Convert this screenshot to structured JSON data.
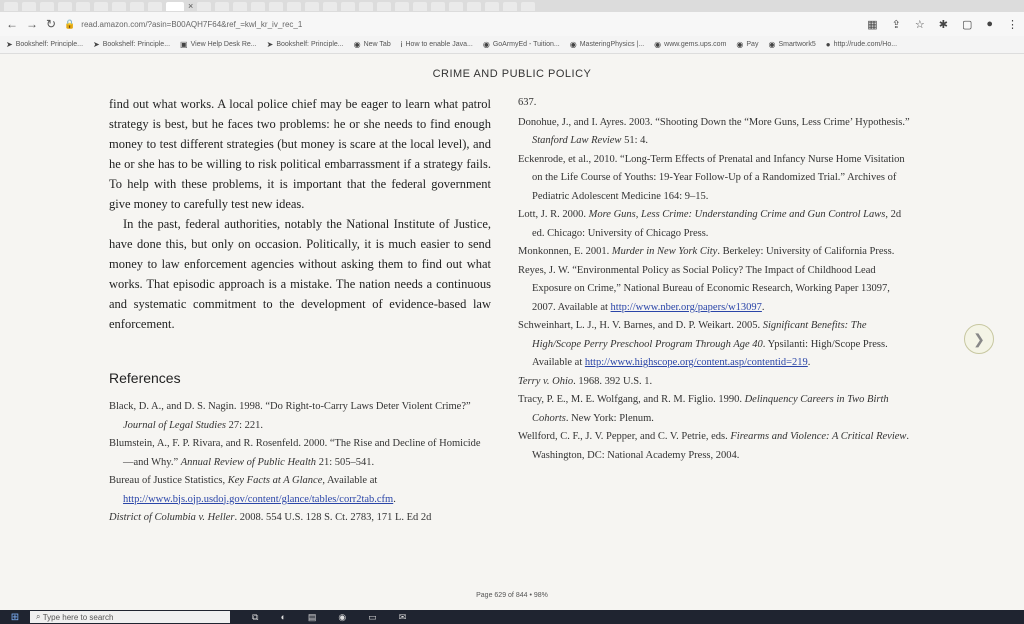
{
  "browser": {
    "address": "read.amazon.com/?asin=B00AQH7F64&ref_=kwl_kr_iv_rec_1",
    "bookmarks": [
      {
        "label": "Bookshelf: Principle...",
        "icon": "arrow-icon"
      },
      {
        "label": "Bookshelf: Principle...",
        "icon": "arrow-icon"
      },
      {
        "label": "View Help Desk Re...",
        "icon": "doc-icon"
      },
      {
        "label": "Bookshelf: Principle...",
        "icon": "arrow-icon"
      },
      {
        "label": "New Tab",
        "icon": "globe-icon"
      },
      {
        "label": "How to enable Java...",
        "icon": "info-icon"
      },
      {
        "label": "GoArmyEd - Tuition...",
        "icon": "globe-icon"
      },
      {
        "label": "MasteringPhysics |...",
        "icon": "globe-icon"
      },
      {
        "label": "www.gems.ups.com",
        "icon": "globe-icon"
      },
      {
        "label": "Pay",
        "icon": "globe-icon"
      },
      {
        "label": "Smartwork5",
        "icon": "globe-icon"
      },
      {
        "label": "http://rude.com/Ho...",
        "icon": "globe-icon"
      }
    ]
  },
  "document": {
    "running_head": "CRIME AND PUBLIC POLICY",
    "left_para_1": "find out what works. A local police chief may be eager to learn what patrol strategy is best, but he faces two problems: he or she needs to find enough money to test different strategies (but money is scare at the local level), and he or she has to be willing to risk political embarrassment if a strategy fails. To help with these problems, it is important that the federal government give money to carefully test new ideas.",
    "left_para_2": "In the past, federal authorities, notably the National Institute of Justice, have done this, but only on occasion. Politically, it is much easier to send money to law enforcement agencies without asking them to find out what works. That episodic approach is a mistake. The nation needs a continuous and systematic commitment to the development of evidence-based law enforcement.",
    "references_heading": "References",
    "left_refs": [
      {
        "pre": "Black, D. A., and D. S. Nagin. 1998. “Do Right-to-Carry Laws Deter Violent Crime?” ",
        "em": "Journal of Legal Studies",
        "post": " 27: 221."
      },
      {
        "pre": "Blumstein, A., F. P. Rivara, and R. Rosenfeld. 2000. “The Rise and Decline of Homicide—and Why.” ",
        "em": "Annual Review of Public Health",
        "post": " 21: 505–541."
      },
      {
        "pre": "Bureau of Justice Statistics, ",
        "em": "Key Facts at A Glance",
        "post": ", Available at ",
        "link": "http://www.bjs.ojp.usdoj.gov/content/glance/tables/corr2tab.cfm",
        "tail": "."
      },
      {
        "pre": "",
        "em": "District of Columbia v. Heller",
        "post": ". 2008. 554 U.S. 128 S. Ct. 2783, 171 L. Ed 2d"
      }
    ],
    "right_continuation": "637.",
    "right_refs": [
      {
        "pre": "Donohue, J., and I. Ayres. 2003. “Shooting Down the “More Guns, Less Crime’ Hypothesis.” ",
        "em": "Stanford Law Review",
        "post": " 51: 4."
      },
      {
        "pre": "Eckenrode, et al., 2010. “Long-Term Effects of Prenatal and Infancy Nurse Home Visitation on the Life Course of Youths: 19-Year Follow-Up of a Randomized Trial.” Archives of Pediatric Adolescent Medicine 164: 9–15.",
        "em": "",
        "post": ""
      },
      {
        "pre": "Lott, J. R. 2000. ",
        "em": "More Guns, Less Crime: Understanding Crime and Gun Control Laws",
        "post": ", 2d ed. Chicago: University of Chicago Press."
      },
      {
        "pre": "Monkonnen, E. 2001. ",
        "em": "Murder in New York City",
        "post": ". Berkeley: University of California Press."
      },
      {
        "pre": "Reyes, J. W. “Environmental Policy as Social Policy? The Impact of Childhood Lead Exposure on Crime,” National Bureau of Economic Research, Working Paper 13097, 2007. Available at ",
        "em": "",
        "post": "",
        "link": "http://www.nber.org/papers/w13097",
        "tail": "."
      },
      {
        "pre": "Schweinhart, L. J., H. V. Barnes, and D. P. Weikart. 2005. ",
        "em": "Significant Benefits: The High/Scope Perry Preschool Program Through Age 40",
        "post": ". Ypsilanti: High/Scope Press. Available at ",
        "link": "http://www.highscope.org/content.asp/contentid=219",
        "tail": "."
      },
      {
        "pre": "",
        "em": "Terry v. Ohio",
        "post": ". 1968. 392 U.S. 1."
      },
      {
        "pre": "Tracy, P. E., M. E. Wolfgang, and R. M. Figlio. 1990. ",
        "em": "Delinquency Careers in Two Birth Cohorts",
        "post": ". New York: Plenum."
      },
      {
        "pre": "Wellford, C. F., J. V. Pepper, and C. V. Petrie, eds. ",
        "em": "Firearms and Violence: A Critical Review",
        "post": ". Washington, DC: National Academy Press, 2004."
      }
    ],
    "page_status": "Page 629 of 844 • 98%"
  },
  "taskbar": {
    "search_placeholder": "Type here to search"
  }
}
